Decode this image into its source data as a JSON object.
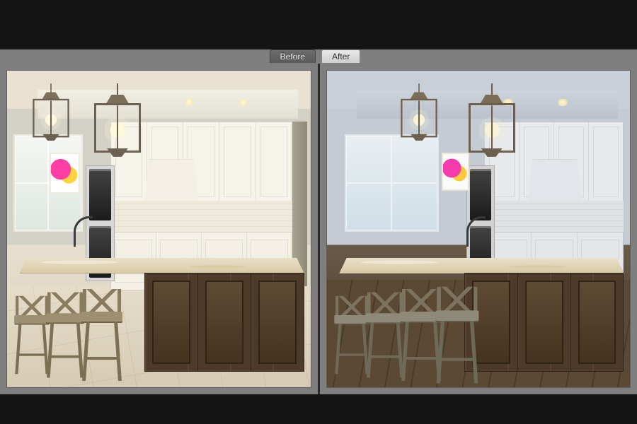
{
  "labels": {
    "before": "Before",
    "after": "After"
  }
}
